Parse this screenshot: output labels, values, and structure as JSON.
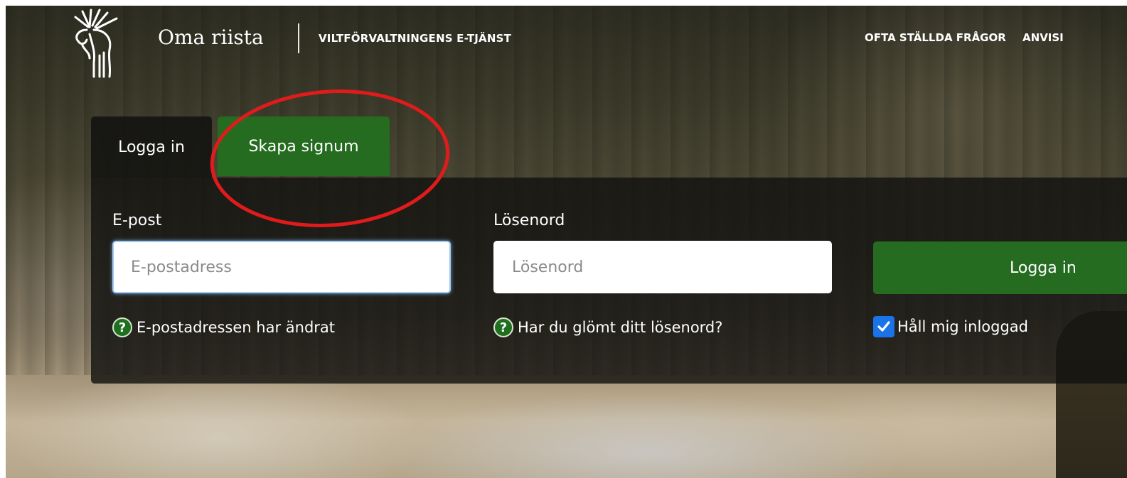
{
  "header": {
    "brand": "Oma riista",
    "service_name": "VILTFÖRVALTNINGENS E-TJÄNST",
    "nav": [
      "OFTA STÄLLDA FRÅGOR",
      "ANVISI"
    ]
  },
  "login": {
    "tabs": [
      {
        "label": "Logga in",
        "active": true
      },
      {
        "label": "Skapa signum",
        "active": false
      }
    ],
    "email": {
      "label": "E-post",
      "placeholder": "E-postadress",
      "value": ""
    },
    "password": {
      "label": "Lösenord",
      "placeholder": "Lösenord",
      "value": ""
    },
    "submit_label": "Logga in",
    "email_changed_link": "E-postadressen har ändrat",
    "forgot_password_link": "Har du glömt ditt lösenord?",
    "remember_me_label": "Håll mig inloggad",
    "remember_me_checked": true
  },
  "colors": {
    "primary_green": "#256c21",
    "annotation_red": "#e01b1b",
    "checkbox_blue": "#1a73e8"
  },
  "icons": [
    "moose-logo-icon",
    "question-icon",
    "checkmark-icon"
  ]
}
